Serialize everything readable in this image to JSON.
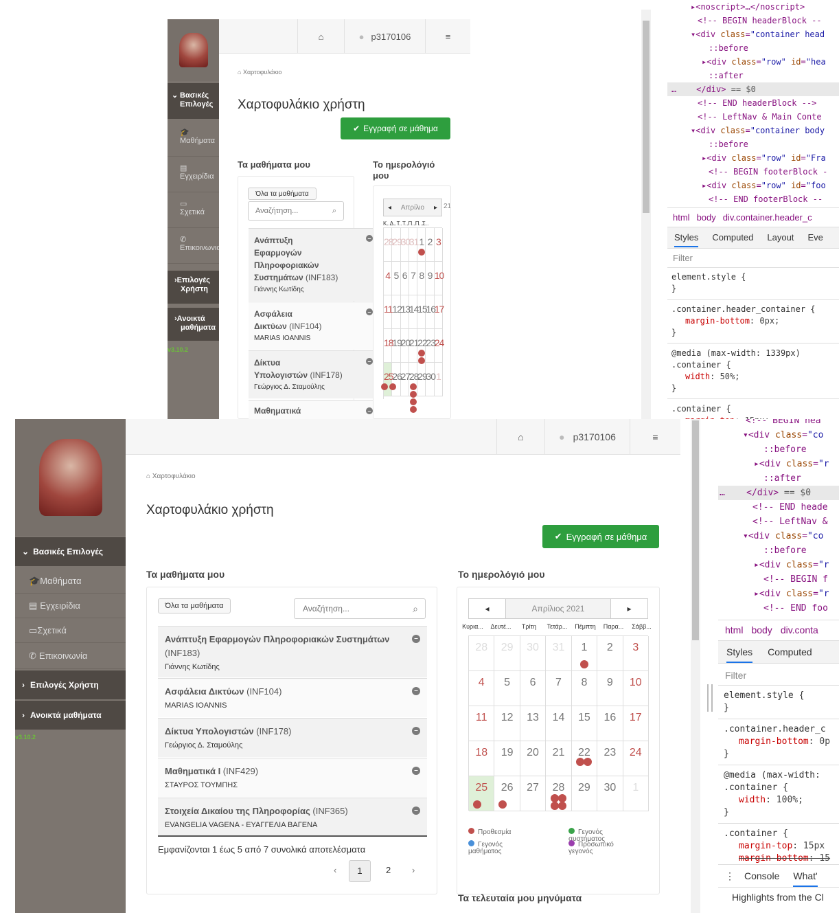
{
  "app": {
    "username": "p3170106",
    "breadcrumb": "Χαρτοφυλάκιο",
    "page_title": "Χαρτοφυλάκιο χρήστη",
    "register_button": "Εγγραφή σε μάθημα",
    "version": "v3.10.2"
  },
  "sidebar": {
    "basic_options": "Βασικές Επιλογές",
    "basic_options_short": [
      "Βασικές",
      "Επιλογές"
    ],
    "items": [
      "Μαθήματα",
      "Εγχειρίδια",
      "Σχετικά",
      "Επικοινωνία"
    ],
    "items_small": [
      "Μαθήματα",
      "Εγχειρίδια",
      "Σχετικά",
      "Επικοινωνια"
    ],
    "user_options": "Επιλογές Χρήστη",
    "user_options_short": [
      "Επιλογές",
      "Χρήστη"
    ],
    "open_courses": "Ανοικτά μαθήματα",
    "open_courses_short": [
      "Ανοικτά",
      "μαθήματα"
    ]
  },
  "courses_panel": {
    "title": "Τα μαθήματα μου",
    "all_courses_button": "Όλα τα μαθήματα",
    "search_placeholder": "Αναζήτηση...",
    "courses": [
      {
        "title": "Ανάπτυξη Εφαρμογών Πληροφοριακών Συστημάτων",
        "code": "(INF183)",
        "professor": "Γιάννης Κωτίδης"
      },
      {
        "title": "Ασφάλεια Δικτύων",
        "code": "(INF104)",
        "professor": "MARIAS IOANNIS"
      },
      {
        "title": "Δίκτυα Υπολογιστών",
        "code": "(INF178)",
        "professor": "Γεώργιος Δ. Σταμούλης"
      },
      {
        "title": "Μαθηματικά Ι",
        "code": "(INF429)",
        "professor": "ΣΤΑΥΡΟΣ ΤΟΥΜΠΗΣ"
      },
      {
        "title": "Στοιχεία Δικαίου της Πληροφορίας",
        "code": "(INF365)",
        "professor": "EVANGELIA VAGENA - ΕΥΑΓΓΕΛΙΑ ΒΑΓΕΝΑ"
      }
    ],
    "results_text": "Εμφανίζονται 1 έως 5 από 7 συνολικά αποτελέσματα",
    "pages": [
      "1",
      "2"
    ],
    "prev": "‹",
    "next": "›"
  },
  "small_courses": [
    {
      "title_lines": [
        "Ανάπτυξη",
        "Εφαρμογών",
        "Πληροφοριακών"
      ],
      "last": "Συστημάτων",
      "code": "(INF183)",
      "professor": "Γιάννης Κωτίδης"
    },
    {
      "title_lines": [
        "Ασφάλεια"
      ],
      "last": "Δικτύων",
      "code": "(INF104)",
      "professor": "MARIAS IOANNIS"
    },
    {
      "title_lines": [
        "Δίκτυα"
      ],
      "last": "Υπολογιστών",
      "code": "(INF178)",
      "professor": "Γεώργιος Δ. Σταμούλης"
    },
    {
      "title_lines": [
        "Μαθηματικά"
      ],
      "last": "",
      "code": "",
      "professor": ""
    }
  ],
  "calendar": {
    "title": "Το ημερολόγιό μου",
    "title_short": [
      "Το ημερολόγιό",
      "μου"
    ],
    "month": "Απρίλιος 2021",
    "month_short": "Απρίλιο",
    "year_fragment": "21",
    "small_daynames": "Κ..Δ..Τ..Τ..Π..Π..Σ..",
    "day_names": [
      "Κυρια...",
      "Δευτέ...",
      "Τρίτη",
      "Τετάρ...",
      "Πέμπτη",
      "Παρα...",
      "Σάββ..."
    ],
    "weeks": [
      [
        "28",
        "29",
        "30",
        "31",
        "1",
        "2",
        "3"
      ],
      [
        "4",
        "5",
        "6",
        "7",
        "8",
        "9",
        "10"
      ],
      [
        "11",
        "12",
        "13",
        "14",
        "15",
        "16",
        "17"
      ],
      [
        "18",
        "19",
        "20",
        "21",
        "22",
        "23",
        "24"
      ],
      [
        "25",
        "26",
        "27",
        "28",
        "29",
        "30",
        "1"
      ]
    ],
    "legend": [
      {
        "label": "Προθεσμία",
        "color": "#c0504d"
      },
      {
        "label": "Γεγονός συστήματος",
        "color": "#3aa34a"
      },
      {
        "label": "Γεγονός μαθήματος",
        "color": "#4a90d9"
      },
      {
        "label": "Προσωπικό γεγονός",
        "color": "#9b3fae"
      }
    ],
    "events": {
      "0-4": 1,
      "3-4": 2,
      "3-3": 0,
      "4-0": 1,
      "4-1": 1,
      "4-3": 4
    }
  },
  "messages_title": "Τα τελευταία μου μηνύματα",
  "devtools": {
    "breadcrumb": [
      "html",
      "body",
      "div.container.header_c"
    ],
    "breadcrumb2": [
      "html",
      "body",
      "div.conta"
    ],
    "tabs": [
      "Styles",
      "Computed",
      "Layout",
      "Eve"
    ],
    "tabs2": [
      "Styles",
      "Computed"
    ],
    "filter": "Filter",
    "console": "Console",
    "whats_new": "What'",
    "highlights": "Highlights from the Cl"
  }
}
